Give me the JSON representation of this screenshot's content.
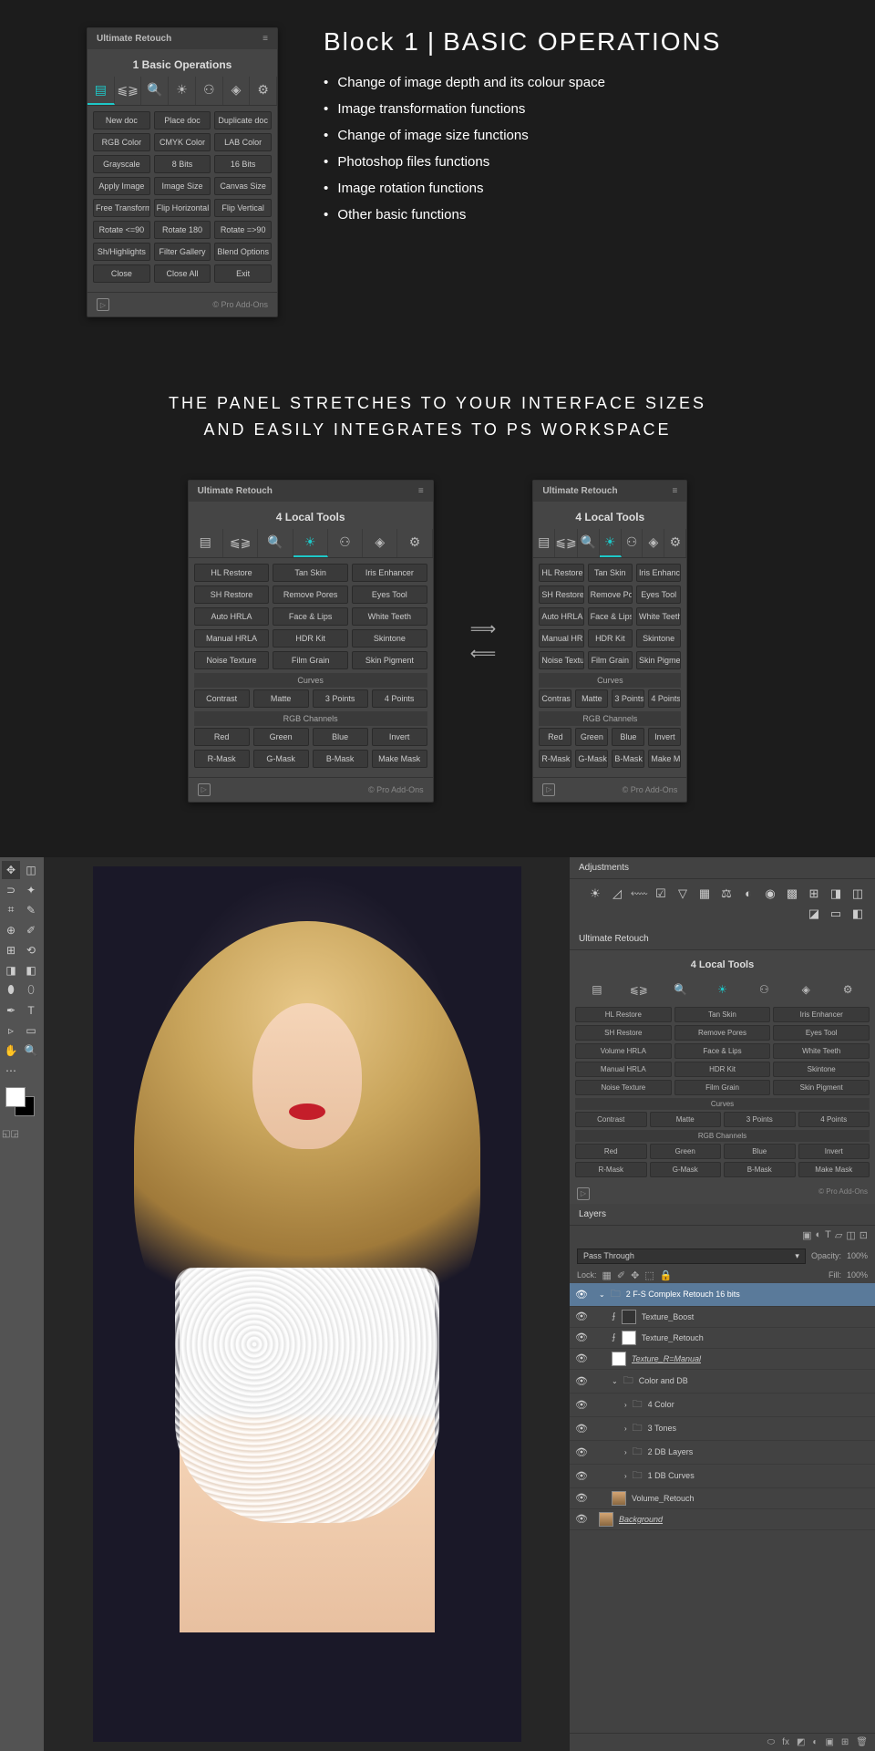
{
  "section1": {
    "panel": {
      "header": "Ultimate Retouch",
      "title": "1 Basic Operations",
      "buttons": [
        [
          "New doc",
          "Place doc",
          "Duplicate doc"
        ],
        [
          "RGB Color",
          "CMYK Color",
          "LAB Color"
        ],
        [
          "Grayscale",
          "8 Bits",
          "16 Bits"
        ],
        [
          "Apply Image",
          "Image Size",
          "Canvas Size"
        ],
        [
          "Free Transform",
          "Flip Horizontal",
          "Flip Vertical"
        ],
        [
          "Rotate <=90",
          "Rotate 180",
          "Rotate =>90"
        ],
        [
          "Sh/Highlights",
          "Filter Gallery",
          "Blend Options"
        ],
        [
          "Close",
          "Close All",
          "Exit"
        ]
      ],
      "footer": "© Pro Add-Ons"
    },
    "heading_pre": "Block 1",
    "heading_main": "BASIC OPERATIONS",
    "bullets": [
      "Change of image depth  and its colour space",
      "Image transformation functions",
      "Change of image size functions",
      "Photoshop files functions",
      "Image rotation functions",
      "Other basic functions"
    ]
  },
  "section2": {
    "title_line1": "THE PANEL STRETCHES TO YOUR INTERFACE SIZES",
    "title_line2": "AND EASILY INTEGRATES TO PS WORKSPACE",
    "panelA": {
      "header": "Ultimate Retouch",
      "title": "4 Local Tools",
      "rows": [
        [
          "HL Restore",
          "Tan Skin",
          "Iris Enhancer"
        ],
        [
          "SH Restore",
          "Remove Pores",
          "Eyes Tool"
        ],
        [
          "Auto HRLA",
          "Face & Lips",
          "White Teeth"
        ],
        [
          "Manual HRLA",
          "HDR Kit",
          "Skintone"
        ],
        [
          "Noise Texture",
          "Film Grain",
          "Skin Pigment"
        ]
      ],
      "label_curves": "Curves",
      "curves_row": [
        "Contrast",
        "Matte",
        "3 Points",
        "4 Points"
      ],
      "label_rgb": "RGB Channels",
      "rgb_row1": [
        "Red",
        "Green",
        "Blue",
        "Invert"
      ],
      "rgb_row2": [
        "R-Mask",
        "G-Mask",
        "B-Mask",
        "Make Mask"
      ],
      "footer": "© Pro Add-Ons"
    },
    "panelB": {
      "header": "Ultimate Retouch",
      "title": "4 Local Tools",
      "rows": [
        [
          "HL Restore",
          "Tan Skin",
          "Iris Enhancer"
        ],
        [
          "SH Restore",
          "Remove Pores",
          "Eyes Tool"
        ],
        [
          "Auto HRLA",
          "Face & Lips",
          "White Teeth"
        ],
        [
          "Manual HRLA",
          "HDR Kit",
          "Skintone"
        ],
        [
          "Noise Texture",
          "Film Grain",
          "Skin Pigment"
        ]
      ],
      "label_curves": "Curves",
      "curves_row": [
        "Contrast",
        "Matte",
        "3 Points",
        "4 Points"
      ],
      "label_rgb": "RGB Channels",
      "rgb_row1": [
        "Red",
        "Green",
        "Blue",
        "Invert"
      ],
      "rgb_row2": [
        "R-Mask",
        "G-Mask",
        "B-Mask",
        "Make Mask"
      ],
      "footer": "© Pro Add-Ons"
    }
  },
  "ps": {
    "adjustments_title": "Adjustments",
    "panel": {
      "header": "Ultimate Retouch",
      "title": "4 Local Tools",
      "rows": [
        [
          "HL Restore",
          "Tan Skin",
          "Iris Enhancer"
        ],
        [
          "SH Restore",
          "Remove Pores",
          "Eyes Tool"
        ],
        [
          "Volume HRLA",
          "Face & Lips",
          "White Teeth"
        ],
        [
          "Manual HRLA",
          "HDR Kit",
          "Skintone"
        ],
        [
          "Noise Texture",
          "Film Grain",
          "Skin Pigment"
        ]
      ],
      "label_curves": "Curves",
      "curves_row": [
        "Contrast",
        "Matte",
        "3 Points",
        "4 Points"
      ],
      "label_rgb": "RGB Channels",
      "rgb_row1": [
        "Red",
        "Green",
        "Blue",
        "Invert"
      ],
      "rgb_row2": [
        "R-Mask",
        "G-Mask",
        "B-Mask",
        "Make Mask"
      ],
      "footer": "© Pro Add-Ons"
    },
    "layers_title": "Layers",
    "blend_mode": "Pass Through",
    "opacity_label": "Opacity:",
    "opacity_value": "100%",
    "lock_label": "Lock:",
    "fill_label": "Fill:",
    "fill_value": "100%",
    "layers": [
      {
        "indent": 0,
        "name": "2 F-S Complex Retouch 16 bits",
        "type": "folder",
        "selected": true,
        "open": true
      },
      {
        "indent": 1,
        "name": "Texture_Boost",
        "type": "fx"
      },
      {
        "indent": 1,
        "name": "Texture_Retouch",
        "type": "fx-thumb"
      },
      {
        "indent": 1,
        "name": "Texture_R=Manual",
        "type": "thumb-italic"
      },
      {
        "indent": 1,
        "name": "Color and DB",
        "type": "folder",
        "open": true
      },
      {
        "indent": 2,
        "name": "4 Color",
        "type": "folder"
      },
      {
        "indent": 2,
        "name": "3 Tones",
        "type": "folder"
      },
      {
        "indent": 2,
        "name": "2 DB Layers",
        "type": "folder"
      },
      {
        "indent": 2,
        "name": "1 DB Curves",
        "type": "folder"
      },
      {
        "indent": 1,
        "name": "Volume_Retouch",
        "type": "photo"
      },
      {
        "indent": 0,
        "name": "Background",
        "type": "photo-bg"
      }
    ]
  }
}
